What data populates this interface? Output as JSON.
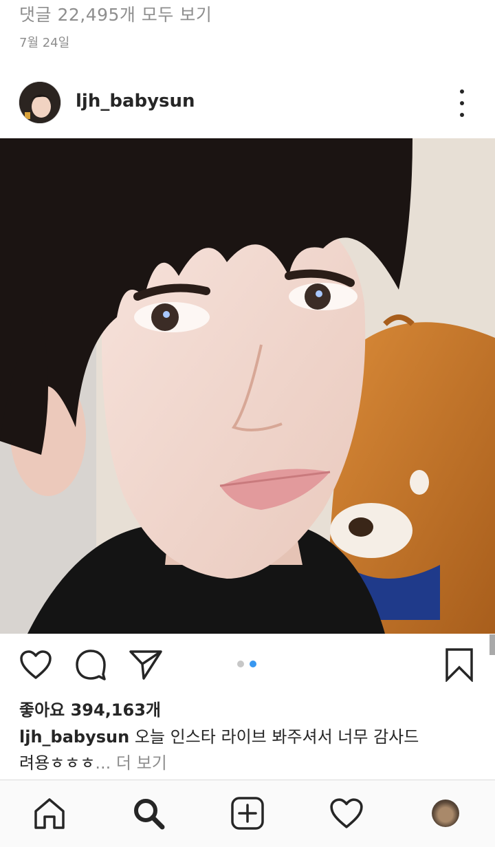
{
  "previous_post": {
    "comments_link": "댓글 22,495개 모두 보기",
    "date": "7월 24일"
  },
  "post": {
    "username": "ljh_babysun",
    "likes": "좋아요 394,163개",
    "caption_user": "ljh_babysun",
    "caption_text": " 오늘 인스타 라이브 봐주셔서 너무 감사드려용ㅎㅎㅎ",
    "caption_more": "... 더 보기",
    "carousel": {
      "count": 2,
      "active_index": 1
    }
  },
  "icons": {
    "like": "heart-icon",
    "comment": "comment-icon",
    "share": "paper-plane-icon",
    "save": "bookmark-icon",
    "more": "more-vertical-icon",
    "home": "home-icon",
    "search": "search-icon",
    "add": "add-post-icon",
    "activity": "heart-icon",
    "profile": "profile-avatar"
  },
  "colors": {
    "text": "#262626",
    "muted": "#8e8e8e",
    "accent": "#3897f0"
  }
}
